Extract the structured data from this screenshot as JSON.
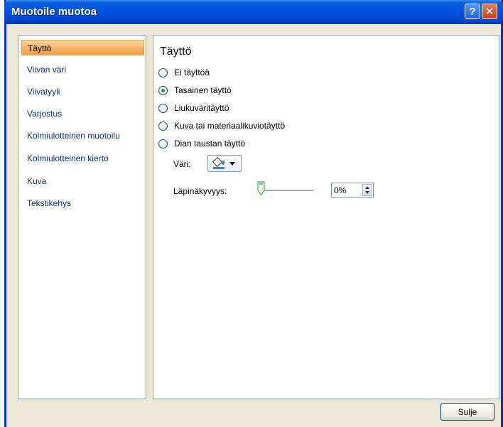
{
  "window": {
    "title": "Muotoile muotoa",
    "help_label": "?",
    "close_label": "✕"
  },
  "nav": {
    "items": [
      {
        "label": "Täyttö",
        "selected": true
      },
      {
        "label": "Viivan väri"
      },
      {
        "label": "Viivatyyli"
      },
      {
        "label": "Varjostus"
      },
      {
        "label": "Kolmiulotteinen muotoilu"
      },
      {
        "label": "Kolmiulotteinen kierto"
      },
      {
        "label": "Kuva"
      },
      {
        "label": "Tekstikehys"
      }
    ]
  },
  "fill": {
    "title": "Täyttö",
    "options": [
      {
        "label": "Ei täyttöä",
        "checked": false
      },
      {
        "label": "Tasainen täyttö",
        "checked": true
      },
      {
        "label": "Liukuväritäyttö",
        "checked": false
      },
      {
        "label": "Kuva tai materiaalikuviotäyttö",
        "checked": false
      },
      {
        "label": "Dian taustan täyttö",
        "checked": false
      }
    ],
    "color_label": "Väri:",
    "color_icon": "paint-bucket-icon",
    "transparency_label": "Läpinäkyvyys:",
    "transparency_value": "0%",
    "transparency_fraction": 0
  },
  "footer": {
    "close_label": "Sulje"
  },
  "colors": {
    "title_bar": "#0054e3",
    "dialog_bg": "#ECE9D8",
    "selected_nav": "#f6b163",
    "color_swatch": "#4f81bd"
  }
}
